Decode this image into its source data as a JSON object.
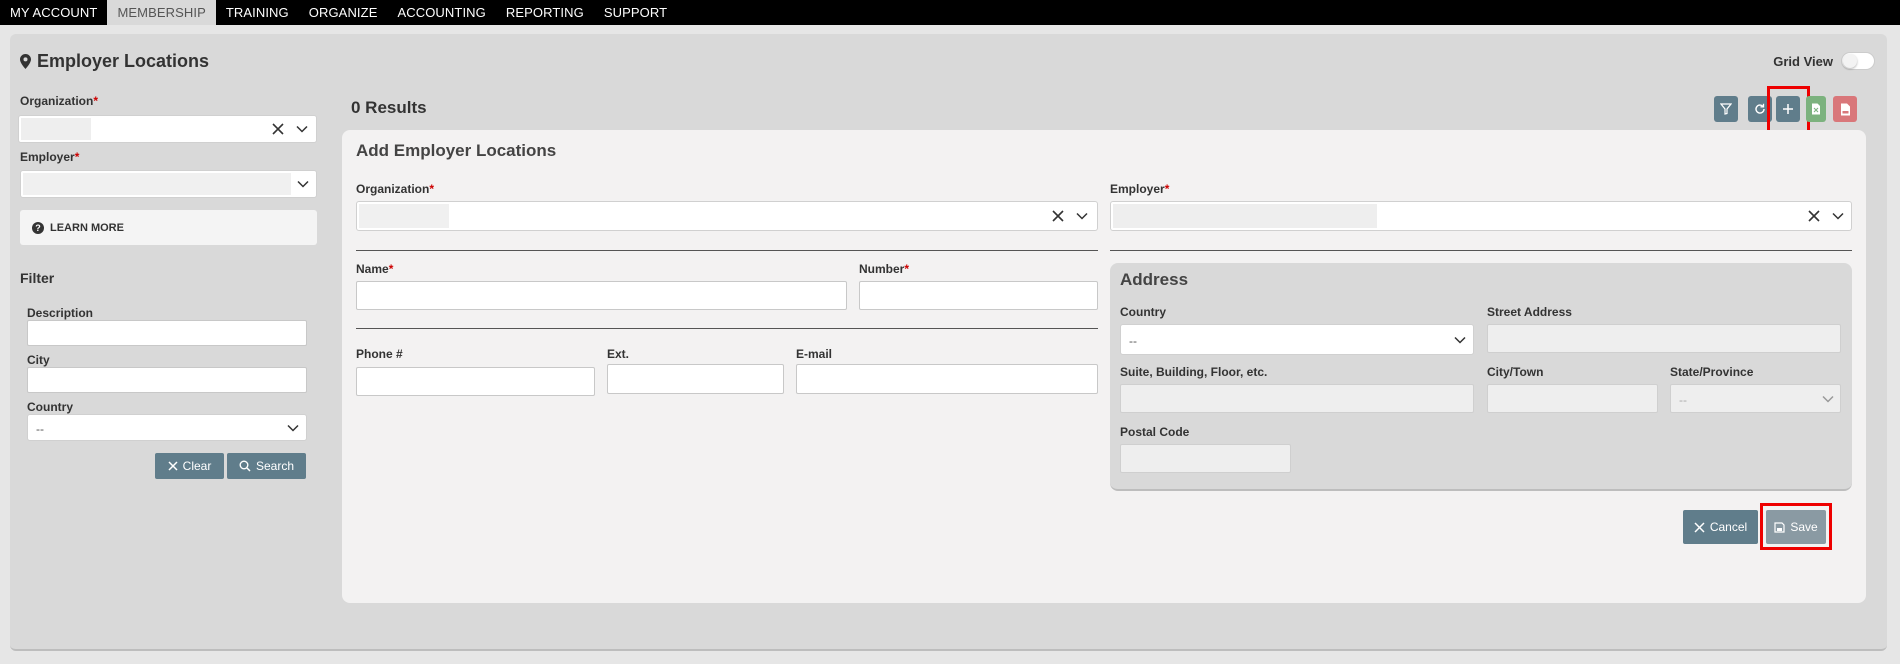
{
  "nav": {
    "items": [
      {
        "label": "MY ACCOUNT"
      },
      {
        "label": "MEMBERSHIP"
      },
      {
        "label": "TRAINING"
      },
      {
        "label": "ORGANIZE"
      },
      {
        "label": "ACCOUNTING"
      },
      {
        "label": "REPORTING"
      },
      {
        "label": "SUPPORT"
      }
    ],
    "active_index": 1
  },
  "page": {
    "title": "Employer Locations",
    "title_icon": "map-pin-icon",
    "grid_view_label": "Grid View"
  },
  "sidebar": {
    "organization_label": "Organization",
    "employer_label": "Employer",
    "required_mark": "*",
    "learn_more_label": "LEARN MORE",
    "filter_title": "Filter",
    "description_label": "Description",
    "city_label": "City",
    "country_label": "Country",
    "country_value": "--",
    "clear_label": "Clear",
    "search_label": "Search"
  },
  "results": {
    "count_text": "0 Results",
    "toolbar_icons": [
      "filter-icon",
      "refresh-icon",
      "add-icon",
      "excel-export-icon",
      "pdf-export-icon"
    ]
  },
  "form": {
    "title": "Add Employer Locations",
    "organization_label": "Organization",
    "employer_label": "Employer",
    "name_label": "Name",
    "number_label": "Number",
    "phone_label": "Phone #",
    "ext_label": "Ext.",
    "email_label": "E-mail",
    "address": {
      "title": "Address",
      "country_label": "Country",
      "country_value": "--",
      "street_label": "Street Address",
      "suite_label": "Suite, Building, Floor, etc.",
      "city_label": "City/Town",
      "state_label": "State/Province",
      "state_value": "--",
      "postal_label": "Postal Code"
    },
    "cancel_label": "Cancel",
    "save_label": "Save"
  },
  "colors": {
    "nav_bg": "#000000",
    "slate_button": "#607d8b",
    "highlight": "#e00000",
    "excel_green": "#7cb27e",
    "pdf_red": "#d9777a",
    "required": "#cc0000"
  }
}
